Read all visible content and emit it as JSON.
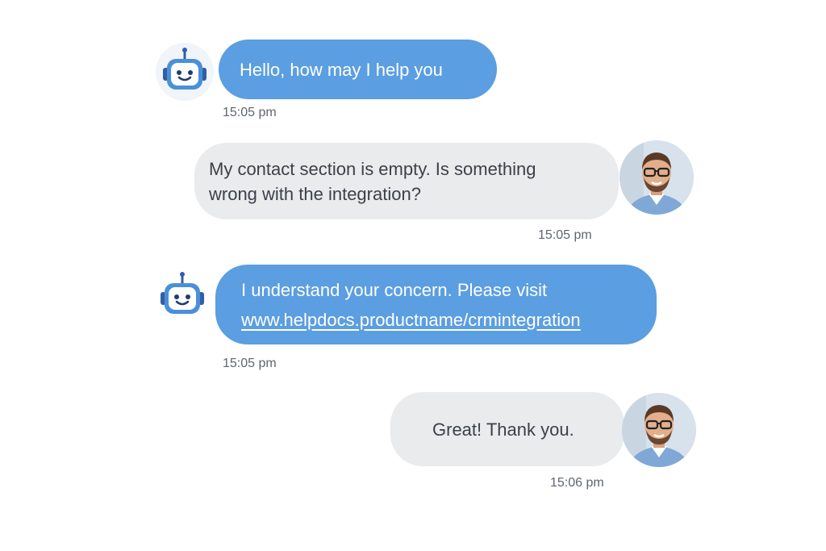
{
  "colors": {
    "bot_bubble": "#5b9ee1",
    "user_bubble": "#eaebed",
    "bot_text": "#ffffff",
    "user_text": "#3b4149",
    "timestamp": "#5f6670"
  },
  "icons": {
    "bot_avatar": "robot-icon",
    "user_avatar": "user-photo-avatar"
  },
  "messages": [
    {
      "sender": "bot",
      "text": "Hello, how may I help you",
      "time": "15:05 pm"
    },
    {
      "sender": "user",
      "line1": "My contact section is empty. Is something",
      "line2": "wrong with the integration?",
      "time": "15:05 pm"
    },
    {
      "sender": "bot",
      "line1": "I understand your concern. Please visit",
      "link": "www.helpdocs.productname/crmintegration",
      "time": "15:05 pm"
    },
    {
      "sender": "user",
      "text": "Great! Thank you.",
      "time": "15:06 pm"
    }
  ]
}
